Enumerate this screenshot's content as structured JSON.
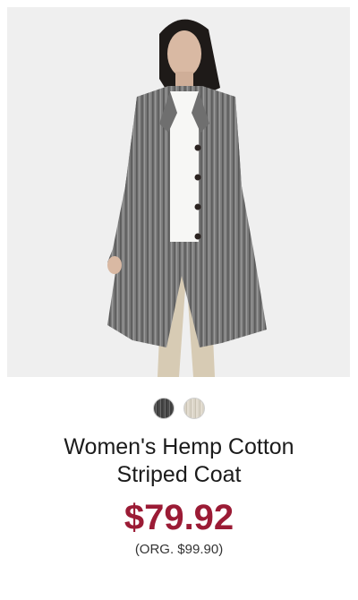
{
  "product": {
    "title": "Women's Hemp Cotton\nStriped Coat",
    "sale_price": "$79.92",
    "original_price": "(ORG. $99.90)"
  },
  "swatches": [
    {
      "name": "gray-stripe",
      "color": "#4a4a4a"
    },
    {
      "name": "natural-stripe",
      "color": "#d9d3c6"
    }
  ],
  "colors": {
    "price": "#9b1b35",
    "background": "#efefef"
  }
}
